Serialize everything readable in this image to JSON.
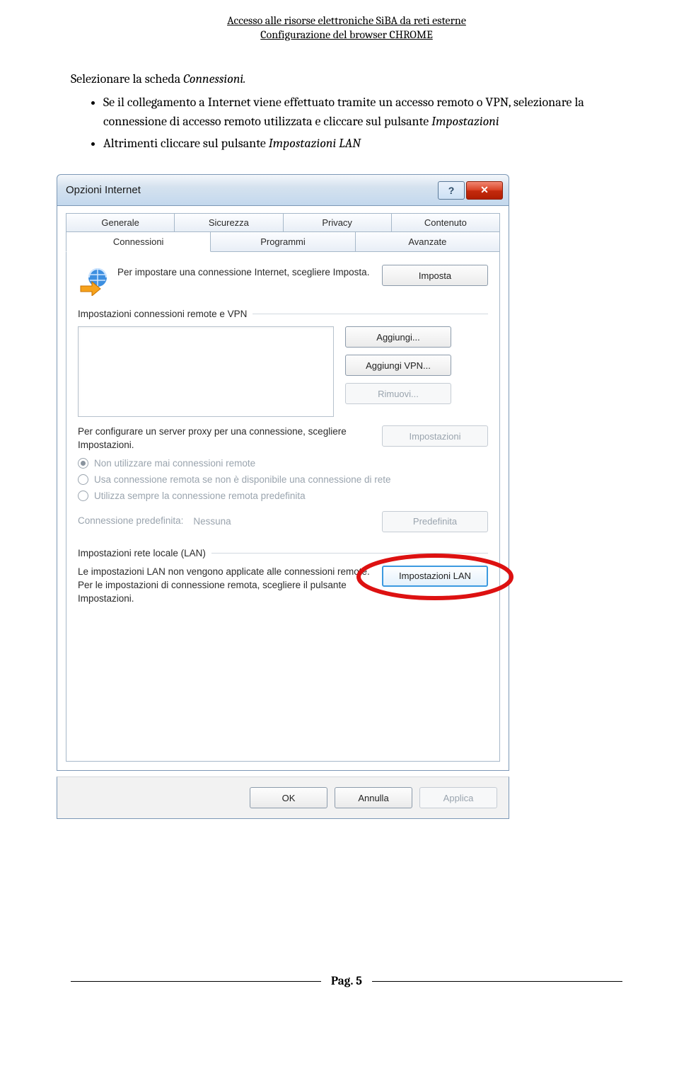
{
  "doc_header": {
    "line1": "Accesso alle risorse elettroniche SiBA da reti esterne",
    "line2": "Configurazione del browser CHROME"
  },
  "body": {
    "intro_before_italic": "Selezionare la scheda ",
    "intro_italic": "Connessioni.",
    "bullets": [
      {
        "pre": "Se il collegamento a Internet viene effettuato tramite un accesso remoto o VPN, selezionare la connessione di accesso remoto utilizzata e cliccare sul pulsante ",
        "italic": "Impostazioni"
      },
      {
        "pre": "Altrimenti cliccare sul pulsante ",
        "italic": "Impostazioni LAN"
      }
    ]
  },
  "dialog": {
    "title": "Opzioni Internet",
    "help_symbol": "?",
    "close_symbol": "✕",
    "tabs_row1": [
      "Generale",
      "Sicurezza",
      "Privacy",
      "Contenuto"
    ],
    "tabs_row2": [
      "Connessioni",
      "Programmi",
      "Avanzate"
    ],
    "setup_text": "Per impostare una connessione Internet, scegliere Imposta.",
    "btn_imposta": "Imposta",
    "group_vpn_legend": "Impostazioni connessioni remote e VPN",
    "btn_aggiungi": "Aggiungi...",
    "btn_aggiungi_vpn": "Aggiungi VPN...",
    "btn_rimuovi": "Rimuovi...",
    "proxy_text": "Per configurare un server proxy per una connessione, scegliere Impostazioni.",
    "btn_impostazioni": "Impostazioni",
    "radio1": "Non utilizzare mai connessioni remote",
    "radio2": "Usa connessione remota se non è disponibile una connessione di rete",
    "radio3": "Utilizza sempre la connessione remota predefinita",
    "default_conn_label": "Connessione predefinita:",
    "default_conn_value": "Nessuna",
    "btn_predefinita": "Predefinita",
    "group_lan_legend": "Impostazioni rete locale (LAN)",
    "lan_text": "Le impostazioni LAN non vengono applicate alle connessioni remote. Per le impostazioni di connessione remota, scegliere il pulsante Impostazioni.",
    "btn_lan": "Impostazioni LAN",
    "btn_ok": "OK",
    "btn_annulla": "Annulla",
    "btn_applica": "Applica"
  },
  "footer": {
    "page_label": "Pag. 5"
  }
}
